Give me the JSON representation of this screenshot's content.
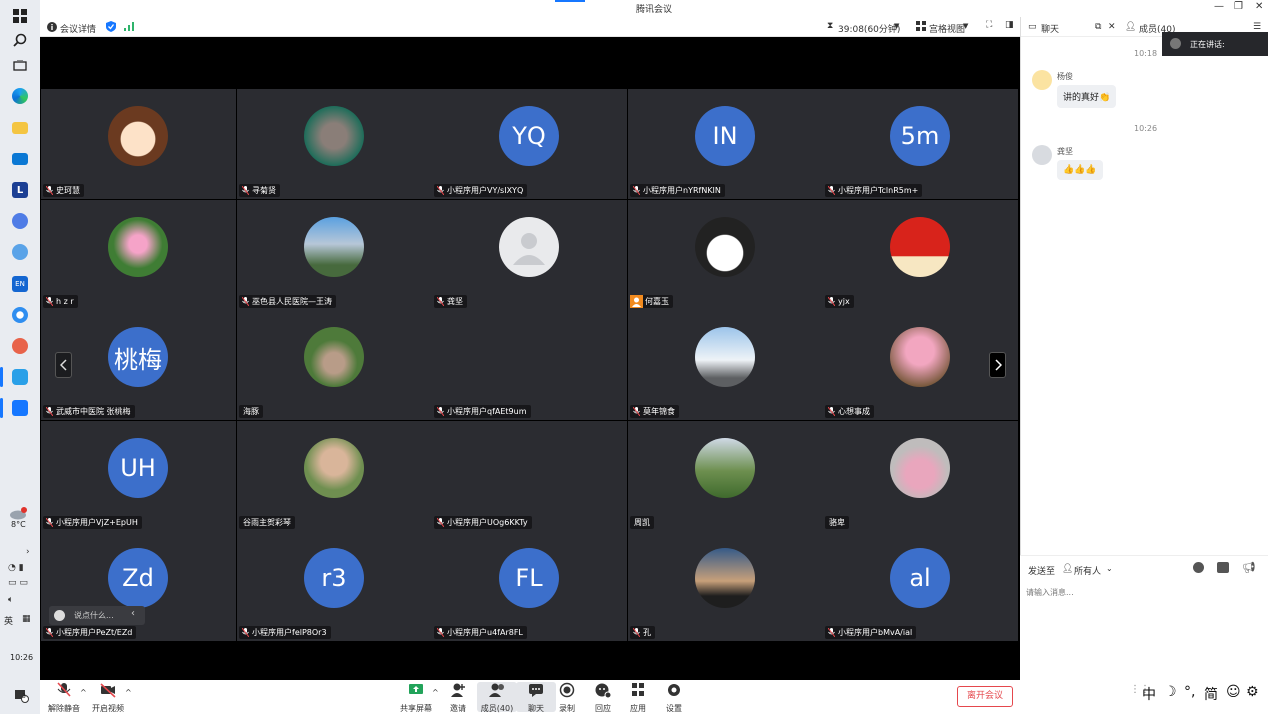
{
  "window": {
    "title": "腾讯会议"
  },
  "topbar": {
    "meeting_details": "会议详情",
    "timer": "39:08(60分钟)",
    "view_mode": "宫格视图"
  },
  "taskbar": {
    "weather_temp": "8°C",
    "lang": "英",
    "time": "10:26",
    "notif_count": "3"
  },
  "participants": [
    {
      "name": "史珂慧",
      "avatar": "cartoon-girl",
      "muted": true
    },
    {
      "name": "寻菊贤",
      "avatar": "photo-elder",
      "muted": true
    },
    {
      "name": "小程序用户VY/sIXYQ",
      "avatar_text": "YQ",
      "muted": true
    },
    {
      "name": "小程序用户nYRfNKIN",
      "avatar_text": "IN",
      "muted": true
    },
    {
      "name": "小程序用户TclnR5m+",
      "avatar_text": "5m",
      "muted": true
    },
    {
      "name": "h z r",
      "avatar": "photo-lotus",
      "muted": true
    },
    {
      "name": "巫色县人民医院—王涛",
      "avatar": "photo-mountain",
      "muted": true
    },
    {
      "name": "龚坚",
      "avatar": "default-person",
      "muted": true
    },
    {
      "name": "何嘉玉",
      "avatar": "cartoon-glasses",
      "muted": false,
      "badge": "orange"
    },
    {
      "name": "yjx",
      "avatar": "photo-flag",
      "muted": true
    },
    {
      "name": "武威市中医院 张桃梅",
      "avatar_text": "桃梅",
      "muted": true
    },
    {
      "name": "海豚",
      "avatar": "photo-meditation",
      "muted": false,
      "no_icon": true
    },
    {
      "name": "小程序用户qfAEt9um",
      "avatar": "none",
      "muted": true
    },
    {
      "name": "莫年锦食",
      "avatar": "photo-snow-mountain",
      "muted": true
    },
    {
      "name": "心想事成",
      "avatar": "photo-hyacinth",
      "muted": true
    },
    {
      "name": "小程序用户VjZ+EpUH",
      "avatar_text": "UH",
      "muted": true
    },
    {
      "name": "谷雨主贺彩琴",
      "avatar": "photo-elder-woman",
      "muted": false,
      "no_icon": true
    },
    {
      "name": "小程序用户UOg6KKTy",
      "avatar": "none",
      "muted": true
    },
    {
      "name": "周凯",
      "avatar": "photo-field",
      "muted": false,
      "no_icon": true
    },
    {
      "name": "骆卑",
      "avatar": "photo-girl-flowers",
      "muted": false,
      "no_icon": true
    },
    {
      "name": "小程序用户PeZt/EZd",
      "avatar_text": "Zd",
      "muted": true
    },
    {
      "name": "小程序用户felP8Or3",
      "avatar_text": "r3",
      "muted": true
    },
    {
      "name": "小程序用户u4fAr8FL",
      "avatar_text": "FL",
      "muted": true
    },
    {
      "name": "孔",
      "avatar": "photo-sunset",
      "muted": true
    },
    {
      "name": "小程序用户bMvA/ial",
      "avatar_text": "al",
      "muted": true
    }
  ],
  "caption_prompt": "说点什么...",
  "chat": {
    "tab_chat": "聊天",
    "tab_members": "成员(40)",
    "speaking_label": "正在讲话:",
    "messages": [
      {
        "time": "10:18",
        "sender": "杨俊",
        "text": "讲的真好👏"
      },
      {
        "time": "10:26",
        "sender": "龚坚",
        "text": "👍👍👍"
      }
    ],
    "send_to_label": "发送至",
    "send_to_value": "所有人",
    "input_placeholder": "请输入消息..."
  },
  "controls": {
    "unmute": "解除静音",
    "start_video": "开启视频",
    "share_screen": "共享屏幕",
    "invite": "邀请",
    "members": "成员(40)",
    "chat": "聊天",
    "record": "录制",
    "reactions": "回应",
    "apps": "应用",
    "settings": "设置",
    "leave": "离开会议"
  },
  "ime": {
    "zh": "中",
    "simplified": "简"
  },
  "colors": {
    "avatar_blue": "#3c6fcb",
    "tile_bg": "#2b2c31",
    "leave_red": "#e5484d",
    "accent_blue": "#1677ff"
  }
}
